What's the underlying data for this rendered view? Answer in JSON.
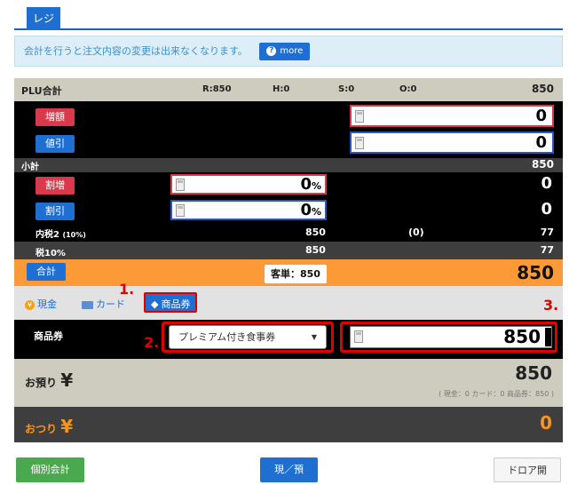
{
  "tab": {
    "label": "レジ"
  },
  "notice": {
    "text": "会計を行うと注文内容の変更は出来なくなります。",
    "more_label": "more"
  },
  "plu": {
    "label": "PLU合計",
    "r": "R:850",
    "h": "H:0",
    "s": "S:0",
    "o": "O:0",
    "total": "850"
  },
  "adjust": {
    "increase_label": "増額",
    "increase_value": "0",
    "discount_label": "値引",
    "discount_value": "0"
  },
  "subtotal": {
    "label": "小計",
    "value": "850"
  },
  "rate": {
    "surcharge_label": "割増",
    "surcharge_value": "0",
    "surcharge_result": "0",
    "discount_label": "割引",
    "discount_value": "0",
    "discount_result": "0",
    "percent": "%"
  },
  "tax_incl": {
    "label": "内税2",
    "rate_note": "(10%)",
    "base": "850",
    "paren": "(0)",
    "tax": "77"
  },
  "tax10": {
    "label": "税10%",
    "base": "850",
    "tax": "77"
  },
  "total": {
    "label": "合計",
    "unit_price": "客単：850",
    "value": "850"
  },
  "pay_tabs": {
    "cash": "現金",
    "card": "カード",
    "voucher": "商品券"
  },
  "voucher": {
    "label": "商品券",
    "select_value": "プレミアム付き食事券",
    "amount": "850"
  },
  "callouts": {
    "one": "1.",
    "two": "2.",
    "three": "3."
  },
  "deposit": {
    "label": "お預り",
    "yen": "¥",
    "value": "850",
    "breakdown": "( 現金：0  カード：0  商品券：850 )"
  },
  "change": {
    "label": "おつり",
    "yen": "¥",
    "value": "0"
  },
  "footer": {
    "split_label": "個別会計",
    "cash_label": "現／預",
    "drawer_label": "ドロア開"
  },
  "colors": {
    "accent": "#1f6fd2",
    "danger": "#d9394b",
    "total_bar": "#fb9a36",
    "annotation": "#e00000"
  }
}
